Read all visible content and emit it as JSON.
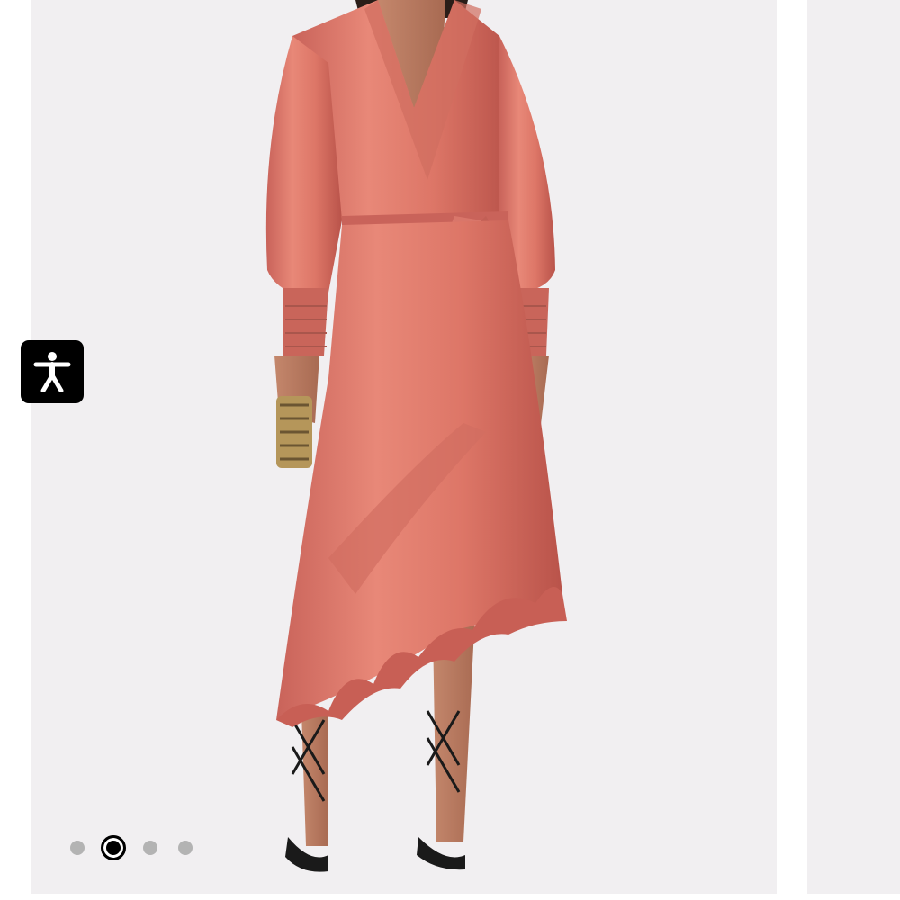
{
  "carousel": {
    "total_slides": 4,
    "active_index": 1,
    "dots": [
      {
        "state": "inactive"
      },
      {
        "state": "active"
      },
      {
        "state": "inactive"
      },
      {
        "state": "inactive"
      }
    ]
  },
  "product_image": {
    "background_color": "#f1eff1",
    "dress_color": "#e0796a",
    "shadow_color": "#b9534a"
  },
  "accessibility": {
    "icon": "accessibility-person-icon",
    "button_color": "#000000"
  }
}
